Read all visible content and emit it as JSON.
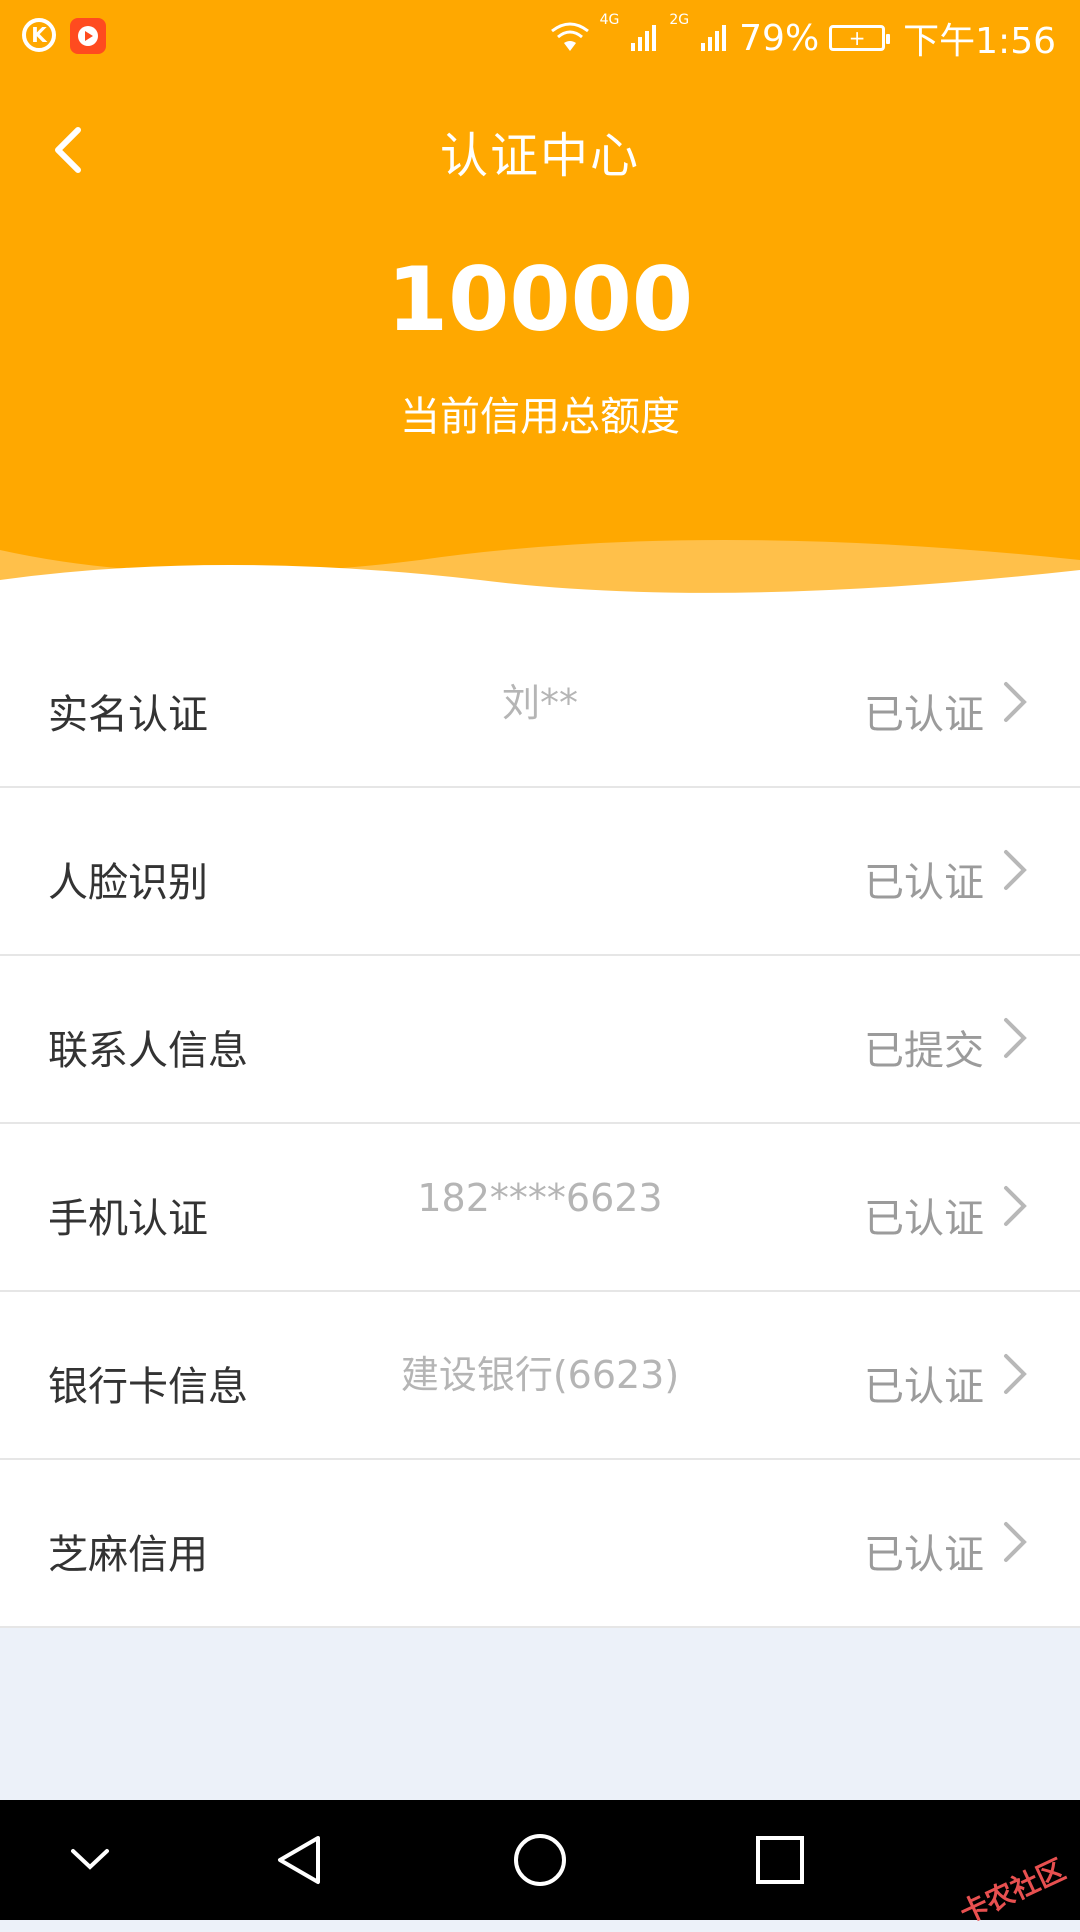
{
  "status_bar": {
    "network_4g": "4G",
    "network_2g": "2G",
    "battery_percent": "79%",
    "time": "下午1:56",
    "k_label": "K"
  },
  "header": {
    "title": "认证中心",
    "credit_amount": "10000",
    "credit_label": "当前信用总额度"
  },
  "list": {
    "items": [
      {
        "title": "实名认证",
        "detail": "刘**",
        "status": "已认证"
      },
      {
        "title": "人脸识别",
        "detail": "",
        "status": "已认证"
      },
      {
        "title": "联系人信息",
        "detail": "",
        "status": "已提交"
      },
      {
        "title": "手机认证",
        "detail": "182****6623",
        "status": "已认证"
      },
      {
        "title": "银行卡信息",
        "detail": "建设银行(6623)",
        "status": "已认证"
      },
      {
        "title": "芝麻信用",
        "detail": "",
        "status": "已认证"
      }
    ]
  },
  "watermark": "卡农社区",
  "colors": {
    "header_bg": "#FFA800",
    "page_bg": "#ECF1F9",
    "title_text": "#333333",
    "status_text": "#9B9B9B",
    "detail_text": "#B5B5B5"
  },
  "icons": {
    "back": "chevron-left-icon",
    "chevron": "chevron-right-icon",
    "nav_down": "chevron-down-icon",
    "nav_back": "triangle-back-icon",
    "nav_home": "circle-home-icon",
    "nav_recent": "square-recent-icon"
  }
}
